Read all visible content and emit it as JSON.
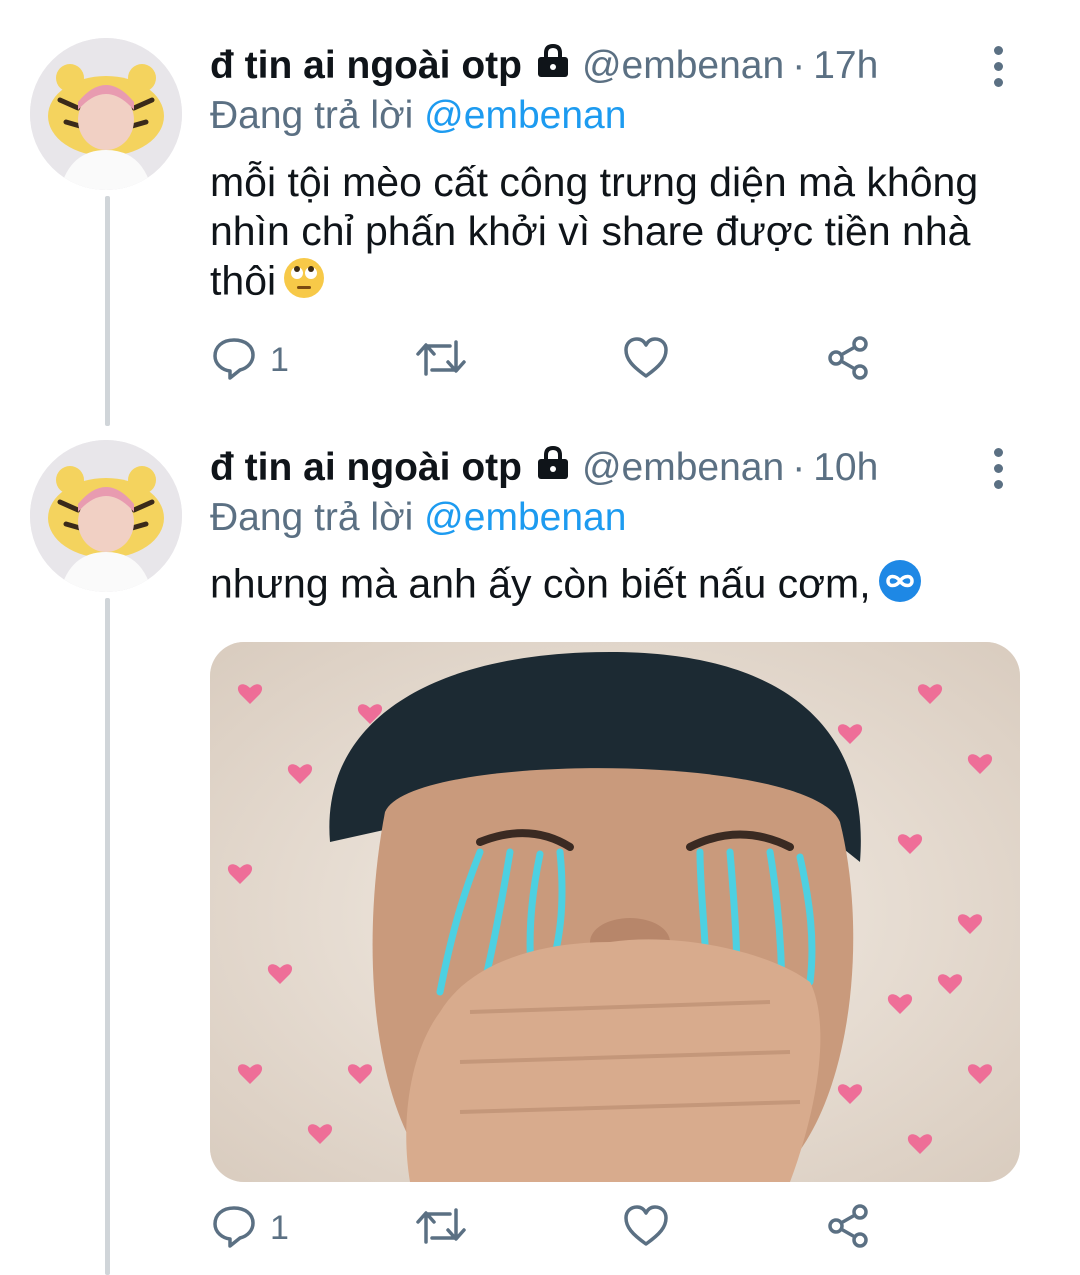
{
  "tweets": [
    {
      "name": "đ tin ai ngoài otp",
      "handle": "@embenan",
      "separator": "·",
      "time": "17h",
      "reply_prefix": "Đang trả lời",
      "reply_mention": "@embenan",
      "text": "mỗi tội mèo cất công trưng diện mà không nhìn chỉ phấn khởi vì share được tiền nhà thôi",
      "emoji": "face-with-rolling-eyes",
      "reply_count": "1"
    },
    {
      "name": "đ tin ai ngoài otp",
      "handle": "@embenan",
      "separator": "·",
      "time": "10h",
      "reply_prefix": "Đang trả lời",
      "reply_mention": "@embenan",
      "text": "nhưng mà anh ấy còn biết nấu cơm,",
      "emoji": "infinity",
      "has_media": true,
      "reply_count": "1"
    }
  ],
  "icons": [
    "more-vertical-icon",
    "lock-icon",
    "reply-icon",
    "retweet-icon",
    "like-icon",
    "share-icon"
  ],
  "colors": {
    "text": "#0f1419",
    "secondary": "#5b7083",
    "link": "#1d9bf0",
    "thread_line": "#d0d5d9",
    "infinity_emoji_bg": "#1e88e5"
  }
}
